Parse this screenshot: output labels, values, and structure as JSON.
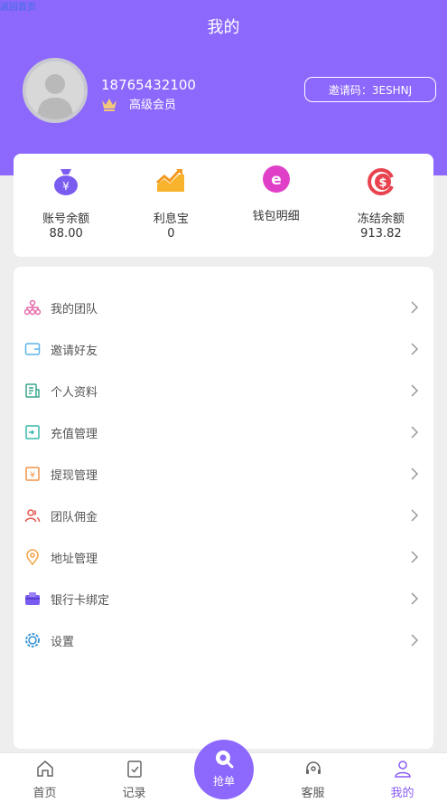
{
  "header": {
    "corner_link": "返回首页",
    "title": "我的"
  },
  "profile": {
    "phone": "18765432100",
    "level": "高级会员",
    "invite_code": "邀请码：3ESHNJ"
  },
  "stats": [
    {
      "label": "账号余额",
      "value": "88.00",
      "icon": "money-bag-icon"
    },
    {
      "label": "利息宝",
      "value": "0",
      "icon": "trend-chart-icon"
    },
    {
      "label": "钱包明细",
      "value": "",
      "icon": "wallet-e-icon"
    },
    {
      "label": "冻结余额",
      "value": "913.82",
      "icon": "dollar-refresh-icon"
    }
  ],
  "menu": [
    {
      "label": "我的团队",
      "icon": "team-tree-icon"
    },
    {
      "label": "邀请好友",
      "icon": "wallet-invite-icon"
    },
    {
      "label": "个人资料",
      "icon": "profile-doc-icon"
    },
    {
      "label": "充值管理",
      "icon": "recharge-icon"
    },
    {
      "label": "提现管理",
      "icon": "withdraw-icon"
    },
    {
      "label": "团队佣金",
      "icon": "users-icon"
    },
    {
      "label": "地址管理",
      "icon": "location-pin-icon"
    },
    {
      "label": "银行卡绑定",
      "icon": "bank-card-icon"
    },
    {
      "label": "设置",
      "icon": "gear-icon"
    }
  ],
  "tabbar": {
    "home": "首页",
    "records": "记录",
    "grab": "抢单",
    "service": "客服",
    "mine": "我的"
  },
  "colors": {
    "accent": "#8c68fc",
    "active_tab": "#8a5cf6"
  }
}
